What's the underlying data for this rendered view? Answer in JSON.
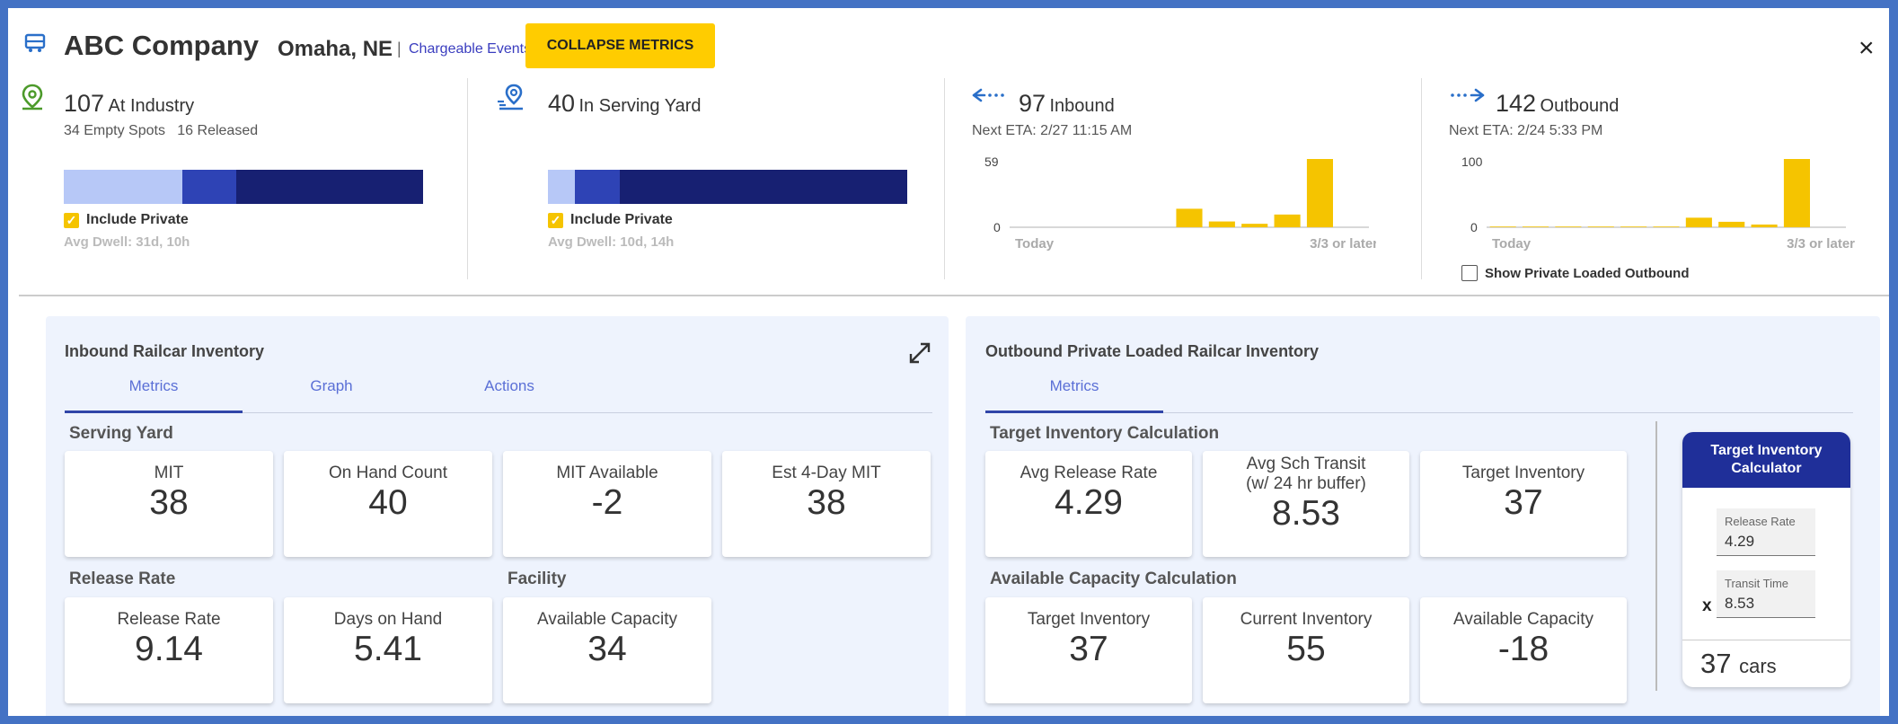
{
  "header": {
    "company": "ABC Company",
    "location": "Omaha, NE",
    "separator": "|",
    "chargeable_events": "Chargeable Events",
    "collapse_button": "COLLAPSE METRICS",
    "close": "×"
  },
  "summary": {
    "industry": {
      "count": "107",
      "label": "At Industry",
      "sub": "34 Empty Spots   16 Released",
      "include_private": "Include Private",
      "include_private_checked": true,
      "avg_dwell": "Avg Dwell: 31d, 10h",
      "bar_segments": [
        {
          "fraction": 0.33,
          "color": "#b7c8f7"
        },
        {
          "fraction": 0.15,
          "color": "#2e43b5"
        },
        {
          "fraction": 0.52,
          "color": "#172072"
        }
      ]
    },
    "serving_yard": {
      "count": "40",
      "label": "In Serving Yard",
      "include_private": "Include Private",
      "include_private_checked": true,
      "avg_dwell": "Avg Dwell: 10d, 14h",
      "bar_segments": [
        {
          "fraction": 0.075,
          "color": "#b7c8f7"
        },
        {
          "fraction": 0.125,
          "color": "#2e43b5"
        },
        {
          "fraction": 0.8,
          "color": "#172072"
        }
      ]
    },
    "inbound": {
      "count": "97",
      "label": "Inbound",
      "next_eta": "Next ETA: 2/27 11:15 AM"
    },
    "outbound": {
      "count": "142",
      "label": "Outbound",
      "next_eta": "Next ETA: 2/24 5:33 PM",
      "show_private": "Show Private Loaded Outbound",
      "show_private_checked": false
    }
  },
  "chart_data": [
    {
      "type": "bar",
      "categories": [
        "Today",
        "",
        "",
        "",
        "",
        "",
        "",
        "",
        "",
        "",
        "3/3 or later"
      ],
      "values": [
        0,
        0,
        0,
        0,
        0,
        16,
        5,
        3,
        11,
        59,
        0
      ],
      "ylim": [
        0,
        59
      ],
      "yticks": [
        "59",
        "0"
      ],
      "xtick_labels": [
        "Today",
        "3/3 or later"
      ],
      "color": "#f5c400"
    },
    {
      "type": "bar",
      "categories": [
        "Today",
        "",
        "",
        "",
        "",
        "",
        "",
        "",
        "",
        "",
        "3/3 or later"
      ],
      "values": [
        1,
        1,
        1,
        1,
        1,
        1,
        14,
        8,
        4,
        100,
        0
      ],
      "ylim": [
        0,
        100
      ],
      "yticks": [
        "100",
        "0"
      ],
      "xtick_labels": [
        "Today",
        "3/3 or later"
      ],
      "color": "#f5c400"
    }
  ],
  "inbound_panel": {
    "title": "Inbound Railcar Inventory",
    "tabs": [
      "Metrics",
      "Graph",
      "Actions"
    ],
    "serving_yard_label": "Serving Yard",
    "release_rate_label": "Release Rate",
    "facility_label": "Facility",
    "cards": {
      "mit": {
        "label": "MIT",
        "value": "38"
      },
      "on_hand": {
        "label": "On Hand Count",
        "value": "40"
      },
      "mit_available": {
        "label": "MIT Available",
        "value": "-2"
      },
      "est_mit": {
        "label": "Est 4-Day MIT",
        "value": "38"
      },
      "release_rate": {
        "label": "Release Rate",
        "value": "9.14"
      },
      "days_on_hand": {
        "label": "Days on Hand",
        "value": "5.41"
      },
      "available_capacity": {
        "label": "Available Capacity",
        "value": "34"
      }
    }
  },
  "outbound_panel": {
    "title": "Outbound Private Loaded Railcar Inventory",
    "tabs": [
      "Metrics"
    ],
    "target_label": "Target Inventory Calculation",
    "available_label": "Available Capacity Calculation",
    "cards": {
      "avg_release": {
        "label": "Avg Release Rate",
        "value": "4.29"
      },
      "avg_transit_1": "Avg Sch Transit",
      "avg_transit_2": "(w/ 24 hr buffer)",
      "avg_transit_value": "8.53",
      "target_inv": {
        "label": "Target Inventory",
        "value": "37"
      },
      "target_inv2": {
        "label": "Target Inventory",
        "value": "37"
      },
      "current_inv": {
        "label": "Current Inventory",
        "value": "55"
      },
      "available_capacity": {
        "label": "Available Capacity",
        "value": "-18"
      }
    },
    "calculator": {
      "title_1": "Target Inventory",
      "title_2": "Calculator",
      "release_rate_label": "Release Rate",
      "release_rate_value": "4.29",
      "transit_label": "Transit Time",
      "transit_value": "8.53",
      "multiply": "x",
      "result_value": "37",
      "result_unit": "cars"
    }
  },
  "colors": {
    "accent_yellow": "#ffcc00",
    "navy": "#1f2f99",
    "link_blue": "#3a3dbf",
    "green_pin": "#4c9a2a",
    "blue_pin": "#2a6fc9"
  }
}
